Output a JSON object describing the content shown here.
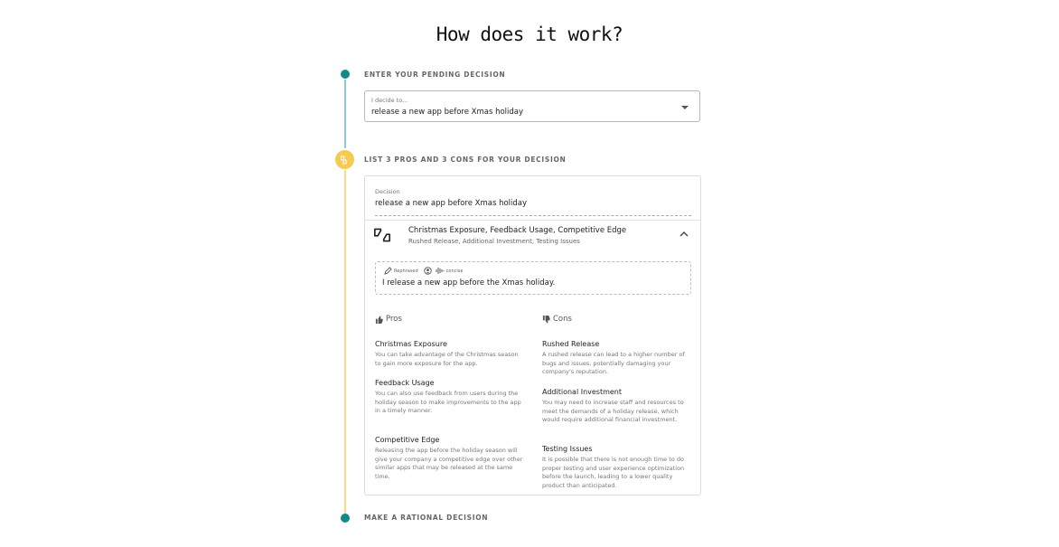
{
  "page": {
    "title": "How does it work?"
  },
  "steps": [
    {
      "label": "ENTER YOUR PENDING DECISION"
    },
    {
      "label": "LIST 3 PROS AND 3 CONS FOR YOUR DECISION"
    },
    {
      "label": "MAKE A RATIONAL DECISION"
    }
  ],
  "decision_select": {
    "label": "I decide to...",
    "value": "release a new app before Xmas holiday"
  },
  "card": {
    "decision_label": "Decision",
    "decision_value": "release a new app before Xmas holiday",
    "accordion": {
      "title": "Christmas Exposure, Feedback Usage, Competitive Edge",
      "subtitle": "Rushed Release, Additional Investment, Testing Issues"
    },
    "rephrase": {
      "tags": [
        "Rephrased",
        "concise"
      ],
      "text": "I release a new app before the Xmas holiday."
    },
    "pros_heading": "Pros",
    "cons_heading": "Cons",
    "pros": [
      {
        "title": "Christmas Exposure",
        "desc": "You can take advantage of the Christmas season to gain more exposure for the app."
      },
      {
        "title": "Feedback Usage",
        "desc": "You can also use feedback from users during the holiday season to make improvements to the app in a timely manner."
      },
      {
        "title": "Competitive Edge",
        "desc": "Releasing the app before the holiday season will give your company a competitive edge over other similar apps that may be released at the same time."
      }
    ],
    "cons": [
      {
        "title": "Rushed Release",
        "desc": "A rushed release can lead to a higher number of bugs and issues, potentially damaging your company's reputation."
      },
      {
        "title": "Additional Investment",
        "desc": "You may need to increase staff and resources to meet the demands of a holiday release, which would require additional financial investment."
      },
      {
        "title": "Testing Issues",
        "desc": "It is possible that there is not enough time to do proper testing and user experience optimization before the launch, leading to a lower quality product than anticipated."
      }
    ]
  },
  "colors": {
    "teal": "#138a86",
    "yellow": "#f6c94f"
  },
  "icons": [
    "pros-cons-icon",
    "chevron-down-icon",
    "chevron-up-icon",
    "pencil-icon",
    "user-icon",
    "waveform-icon",
    "thumbs-up-icon",
    "thumbs-down-icon"
  ]
}
